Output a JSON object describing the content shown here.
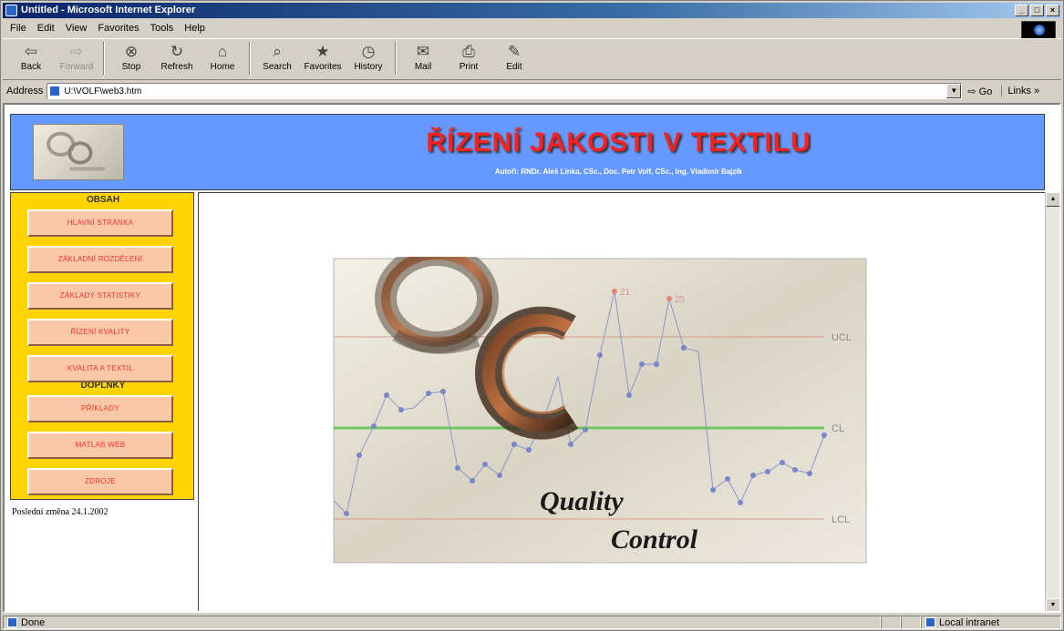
{
  "window": {
    "title": "Untitled - Microsoft Internet Explorer",
    "controls": [
      "_",
      "□",
      "×"
    ]
  },
  "menu": [
    "File",
    "Edit",
    "View",
    "Favorites",
    "Tools",
    "Help"
  ],
  "toolbar": [
    {
      "label": "Back",
      "icon": "back-arrow-icon",
      "glyph": "⇦",
      "enabled": true
    },
    {
      "label": "Forward",
      "icon": "forward-arrow-icon",
      "glyph": "⇨",
      "enabled": false
    },
    {
      "label": "Stop",
      "icon": "stop-icon",
      "glyph": "⊗",
      "enabled": true
    },
    {
      "label": "Refresh",
      "icon": "refresh-icon",
      "glyph": "↻",
      "enabled": true
    },
    {
      "label": "Home",
      "icon": "home-icon",
      "glyph": "⌂",
      "enabled": true
    },
    {
      "label": "Search",
      "icon": "search-icon",
      "glyph": "⌕",
      "enabled": true
    },
    {
      "label": "Favorites",
      "icon": "favorites-icon",
      "glyph": "★",
      "enabled": true
    },
    {
      "label": "History",
      "icon": "history-icon",
      "glyph": "◷",
      "enabled": true
    },
    {
      "label": "Mail",
      "icon": "mail-icon",
      "glyph": "✉",
      "enabled": true
    },
    {
      "label": "Print",
      "icon": "print-icon",
      "glyph": "⎙",
      "enabled": true
    },
    {
      "label": "Edit",
      "icon": "edit-icon",
      "glyph": "✎",
      "enabled": true
    }
  ],
  "address": {
    "label": "Address",
    "value": "U:\\VOLF\\web3.htm",
    "go_label": "Go",
    "links_label": "Links »"
  },
  "page": {
    "banner_title": "ŘÍZENÍ JAKOSTI V TEXTILU",
    "authors": "Autoři: RNDr. Aleš Linka, CSc., Doc. Petr Volf, CSc., Ing. Vladimír Bajzík",
    "sections": {
      "contents": "OBSAH",
      "extras": "DOPLŇKY"
    },
    "nav": [
      "HLAVNÍ STRÁNKA",
      "ZÁKLADNÍ ROZDĚLENÍ",
      "ZÁKLADY STATISTIKY",
      "ŘÍZENÍ KVALITY",
      "KVALITA A TEXTIL"
    ],
    "extras": [
      "PŘÍKLADY",
      "MATLAB WEB",
      "ZDROJE"
    ],
    "last_modified": "Poslední změna 24.1.2002",
    "qc_image": {
      "limits": {
        "ucl": "UCL",
        "cl": "CL",
        "lcl": "LCL"
      },
      "point_labels": [
        "21",
        "25"
      ],
      "caption_1": "Quality",
      "caption_2": "Control"
    }
  },
  "status": {
    "text": "Done",
    "zone": "Local intranet"
  }
}
